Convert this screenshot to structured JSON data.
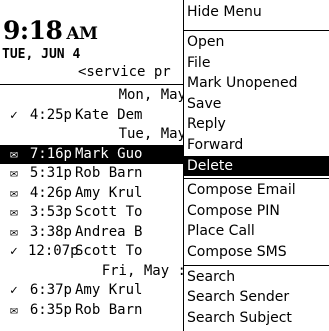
{
  "header": {
    "time": "9:18",
    "ampm": "AM",
    "date": "TUE, JUN 4",
    "service": "<service pr"
  },
  "messages": [
    {
      "kind": "day",
      "label": "Mon, May"
    },
    {
      "kind": "msg",
      "icon": "check-mark",
      "glyph": "✓",
      "time": "4:25p",
      "name": "Kate Dem"
    },
    {
      "kind": "day",
      "label": "Tue, May"
    },
    {
      "kind": "msg",
      "icon": "open-envelope",
      "glyph": "✉",
      "time": "7:16p",
      "name": "Mark Guo",
      "selected": true
    },
    {
      "kind": "msg",
      "icon": "closed-envelope",
      "glyph": "✉",
      "time": "5:31p",
      "name": "Rob Barn"
    },
    {
      "kind": "msg",
      "icon": "open-envelope",
      "glyph": "✉",
      "time": "4:26p",
      "name": "Amy Krul"
    },
    {
      "kind": "msg",
      "icon": "open-envelope",
      "glyph": "✉",
      "time": "3:53p",
      "name": "Scott To"
    },
    {
      "kind": "msg",
      "icon": "open-envelope",
      "glyph": "✉",
      "time": "3:38p",
      "name": "Andrea B"
    },
    {
      "kind": "msg",
      "icon": "check-mark",
      "glyph": "✓",
      "time": "12:07p",
      "name": "Scott To"
    },
    {
      "kind": "day",
      "label": "Fri, May :"
    },
    {
      "kind": "msg",
      "icon": "check-mark",
      "glyph": "✓",
      "time": "6:37p",
      "name": "Amy Krul"
    },
    {
      "kind": "msg",
      "icon": "open-envelope",
      "glyph": "✉",
      "time": "6:35p",
      "name": "Rob Barn"
    }
  ],
  "menu": {
    "hide": "Hide Menu",
    "group1": [
      "Open",
      "File",
      "Mark Unopened",
      "Save",
      "Reply",
      "Forward",
      "Delete"
    ],
    "selected": "Delete",
    "group2": [
      "Compose Email",
      "Compose PIN",
      "Place Call",
      "Compose SMS"
    ],
    "group3": [
      "Search",
      "Search Sender",
      "Search Subject"
    ]
  }
}
